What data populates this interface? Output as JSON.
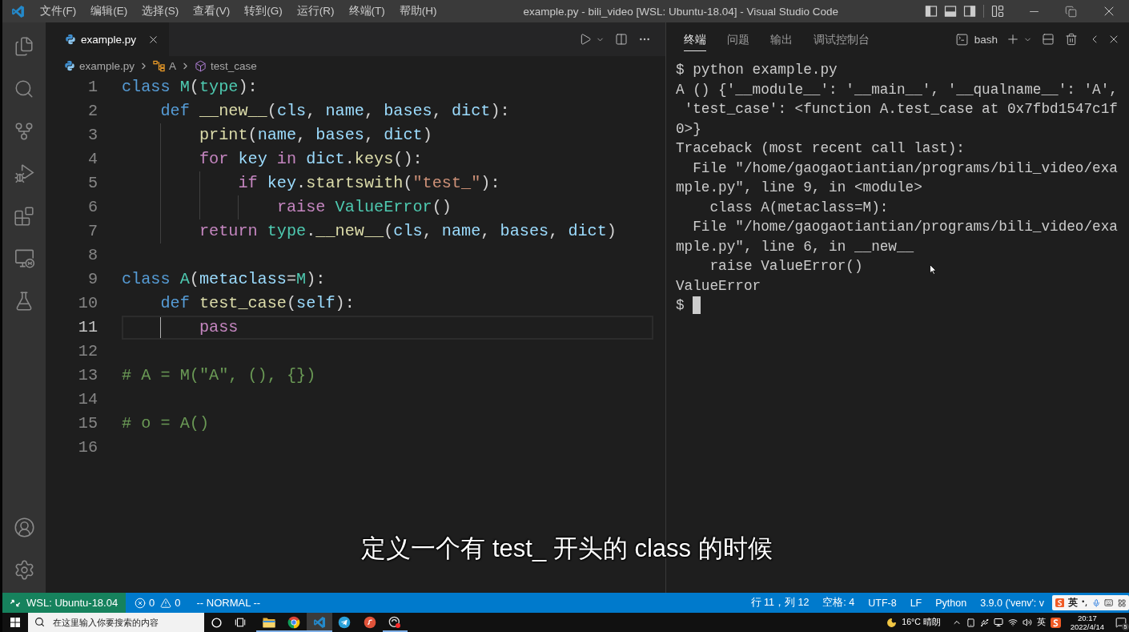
{
  "window": {
    "title": "example.py - bili_video [WSL: Ubuntu-18.04] - Visual Studio Code",
    "menu": [
      "文件(F)",
      "编辑(E)",
      "选择(S)",
      "查看(V)",
      "转到(G)",
      "运行(R)",
      "终端(T)",
      "帮助(H)"
    ]
  },
  "editor": {
    "tabs": [
      {
        "label": "example.py",
        "selected": true
      }
    ],
    "breadcrumbs": [
      {
        "kind": "file",
        "label": "example.py"
      },
      {
        "kind": "class",
        "label": "A"
      },
      {
        "kind": "method",
        "label": "test_case"
      }
    ],
    "lines": [
      {
        "number": "1",
        "current": false,
        "tokens": [
          {
            "kind": "keyword",
            "text": "class "
          },
          {
            "kind": "type",
            "text": "M"
          },
          {
            "kind": "punct",
            "text": "("
          },
          {
            "kind": "type",
            "text": "type"
          },
          {
            "kind": "punct",
            "text": "):"
          }
        ]
      },
      {
        "number": "2",
        "current": false,
        "tokens": [
          {
            "kind": "keyword",
            "text": "    def "
          },
          {
            "kind": "function",
            "text": "__new__"
          },
          {
            "kind": "punct",
            "text": "("
          },
          {
            "kind": "variable",
            "text": "cls"
          },
          {
            "kind": "punct",
            "text": ", "
          },
          {
            "kind": "variable",
            "text": "name"
          },
          {
            "kind": "punct",
            "text": ", "
          },
          {
            "kind": "variable",
            "text": "bases"
          },
          {
            "kind": "punct",
            "text": ", "
          },
          {
            "kind": "variable",
            "text": "dict"
          },
          {
            "kind": "punct",
            "text": "):"
          }
        ]
      },
      {
        "number": "3",
        "current": false,
        "tokens": [
          {
            "kind": "function",
            "text": "        print"
          },
          {
            "kind": "punct",
            "text": "("
          },
          {
            "kind": "variable",
            "text": "name"
          },
          {
            "kind": "punct",
            "text": ", "
          },
          {
            "kind": "variable",
            "text": "bases"
          },
          {
            "kind": "punct",
            "text": ", "
          },
          {
            "kind": "variable",
            "text": "dict"
          },
          {
            "kind": "punct",
            "text": ")"
          }
        ]
      },
      {
        "number": "4",
        "current": false,
        "tokens": [
          {
            "kind": "control",
            "text": "        for "
          },
          {
            "kind": "variable",
            "text": "key"
          },
          {
            "kind": "control",
            "text": " in "
          },
          {
            "kind": "variable",
            "text": "dict"
          },
          {
            "kind": "punct",
            "text": "."
          },
          {
            "kind": "function",
            "text": "keys"
          },
          {
            "kind": "punct",
            "text": "():"
          }
        ]
      },
      {
        "number": "5",
        "current": false,
        "tokens": [
          {
            "kind": "control",
            "text": "            if "
          },
          {
            "kind": "variable",
            "text": "key"
          },
          {
            "kind": "punct",
            "text": "."
          },
          {
            "kind": "function",
            "text": "startswith"
          },
          {
            "kind": "punct",
            "text": "("
          },
          {
            "kind": "string",
            "text": "\"test_\""
          },
          {
            "kind": "punct",
            "text": "):"
          }
        ]
      },
      {
        "number": "6",
        "current": false,
        "tokens": [
          {
            "kind": "control",
            "text": "                raise "
          },
          {
            "kind": "type",
            "text": "ValueError"
          },
          {
            "kind": "punct",
            "text": "()"
          }
        ]
      },
      {
        "number": "7",
        "current": false,
        "tokens": [
          {
            "kind": "control",
            "text": "        return "
          },
          {
            "kind": "type",
            "text": "type"
          },
          {
            "kind": "punct",
            "text": "."
          },
          {
            "kind": "function",
            "text": "__new__"
          },
          {
            "kind": "punct",
            "text": "("
          },
          {
            "kind": "variable",
            "text": "cls"
          },
          {
            "kind": "punct",
            "text": ", "
          },
          {
            "kind": "variable",
            "text": "name"
          },
          {
            "kind": "punct",
            "text": ", "
          },
          {
            "kind": "variable",
            "text": "bases"
          },
          {
            "kind": "punct",
            "text": ", "
          },
          {
            "kind": "variable",
            "text": "dict"
          },
          {
            "kind": "punct",
            "text": ")"
          }
        ]
      },
      {
        "number": "8",
        "current": false
      },
      {
        "number": "9",
        "current": false,
        "tokens": [
          {
            "kind": "keyword",
            "text": "class "
          },
          {
            "kind": "type",
            "text": "A"
          },
          {
            "kind": "punct",
            "text": "("
          },
          {
            "kind": "variable",
            "text": "metaclass"
          },
          {
            "kind": "punct",
            "text": "="
          },
          {
            "kind": "type",
            "text": "M"
          },
          {
            "kind": "punct",
            "text": "):"
          }
        ]
      },
      {
        "number": "10",
        "current": false,
        "tokens": [
          {
            "kind": "keyword",
            "text": "    def "
          },
          {
            "kind": "function",
            "text": "test_case"
          },
          {
            "kind": "punct",
            "text": "("
          },
          {
            "kind": "variable",
            "text": "self"
          },
          {
            "kind": "punct",
            "text": "):"
          }
        ]
      },
      {
        "number": "11",
        "current": true,
        "tokens": [
          {
            "kind": "control",
            "text": "        pass"
          }
        ]
      },
      {
        "number": "12",
        "current": false
      },
      {
        "number": "13",
        "current": false,
        "tokens": [
          {
            "kind": "comment",
            "text": "# A = M(\"A\", (), {})"
          }
        ]
      },
      {
        "number": "14",
        "current": false
      },
      {
        "number": "15",
        "current": false,
        "tokens": [
          {
            "kind": "comment",
            "text": "# o = A()"
          }
        ]
      },
      {
        "number": "16",
        "current": false
      }
    ]
  },
  "panel": {
    "tabs": [
      {
        "label": "终端",
        "selected": true
      },
      {
        "label": "问题",
        "selected": false
      },
      {
        "label": "输出",
        "selected": false
      },
      {
        "label": "调试控制台",
        "selected": false
      }
    ],
    "shell": "bash",
    "lines": [
      "$ python example.py",
      "A () {'__module__': '__main__', '__qualname__': 'A',",
      " 'test_case': <function A.test_case at 0x7fbd1547c1f",
      "0>}",
      "Traceback (most recent call last):",
      "  File \"/home/gaogaotiantian/programs/bili_video/exa",
      "mple.py\", line 9, in <module>",
      "    class A(metaclass=M):",
      "  File \"/home/gaogaotiantian/programs/bili_video/exa",
      "mple.py\", line 6, in __new__",
      "    raise ValueError()",
      "ValueError"
    ],
    "prompt": "$"
  },
  "subtitle": "定义一个有 test_ 开头的 class 的时候",
  "status_bar": {
    "remote": "WSL: Ubuntu-18.04",
    "errors": "0",
    "warnings": "0",
    "mode": "-- NORMAL --",
    "items": [
      "行 11，列 12",
      "空格: 4",
      "UTF-8",
      "LF",
      "Python",
      "3.9.0 ('venv': v"
    ]
  },
  "ime_bar": {
    "language": "英"
  },
  "taskbar": {
    "search": {
      "placeholder": "在这里输入你要搜索的内容"
    },
    "apps": [
      {
        "kind": "folder",
        "selected": false,
        "running": true
      },
      {
        "kind": "browser",
        "selected": false,
        "running": true
      },
      {
        "kind": "editor",
        "selected": true,
        "running": true
      },
      {
        "kind": "messenger",
        "selected": false,
        "running": false
      },
      {
        "kind": "remote",
        "selected": false,
        "running": false
      },
      {
        "kind": "recorder",
        "selected": false,
        "running": true
      }
    ],
    "weather": "16°C 晴朗",
    "input_language": "英",
    "time": "20:17",
    "date": "2022/4/14",
    "notification_count": "5"
  }
}
